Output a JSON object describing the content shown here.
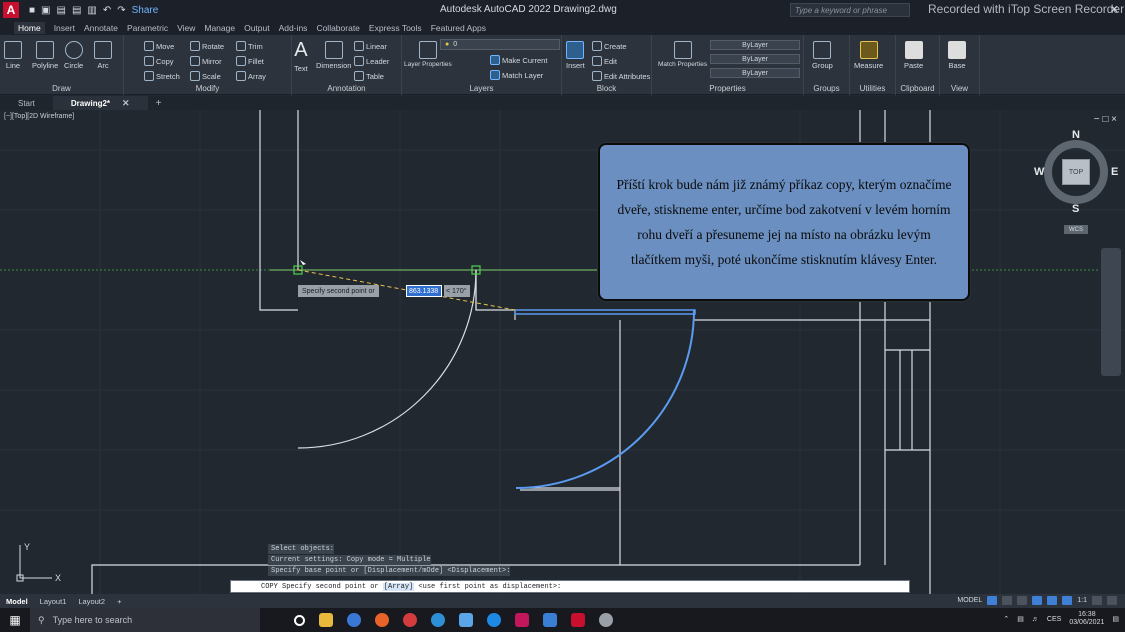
{
  "titlebar": {
    "app_logo": "A",
    "share": "Share",
    "title": "Autodesk AutoCAD 2022   Drawing2.dwg",
    "search_placeholder": "Type a keyword or phrase",
    "recorder_watermark": "Recorded with iTop Screen Recorder"
  },
  "ribbon_tabs": [
    "Home",
    "Insert",
    "Annotate",
    "Parametric",
    "View",
    "Manage",
    "Output",
    "Add-ins",
    "Collaborate",
    "Express Tools",
    "Featured Apps"
  ],
  "ribbon": {
    "draw": {
      "title": "Draw",
      "line": "Line",
      "polyline": "Polyline",
      "circle": "Circle",
      "arc": "Arc"
    },
    "modify": {
      "title": "Modify",
      "move": "Move",
      "rotate": "Rotate",
      "trim": "Trim",
      "copy": "Copy",
      "mirror": "Mirror",
      "fillet": "Fillet",
      "stretch": "Stretch",
      "scale": "Scale",
      "array": "Array"
    },
    "annotation": {
      "title": "Annotation",
      "text": "Text",
      "dimension": "Dimension",
      "linear": "Linear",
      "leader": "Leader",
      "table": "Table"
    },
    "layers": {
      "title": "Layers",
      "layer_properties": "Layer Properties",
      "layer_value": "0",
      "make_current": "Make Current",
      "match_layer": "Match Layer"
    },
    "block": {
      "title": "Block",
      "insert": "Insert",
      "create": "Create",
      "edit": "Edit",
      "edit_attributes": "Edit Attributes"
    },
    "properties": {
      "title": "Properties",
      "match_properties": "Match Properties",
      "bylayer_1": "ByLayer",
      "bylayer_2": "ByLayer",
      "bylayer_3": "ByLayer"
    },
    "groups": {
      "title": "Groups",
      "group": "Group"
    },
    "utilities": {
      "title": "Utilities",
      "measure": "Measure"
    },
    "clipboard": {
      "title": "Clipboard",
      "paste": "Paste"
    },
    "view": {
      "title": "View",
      "base": "Base"
    }
  },
  "doc_tabs": {
    "start": "Start",
    "drawing": "Drawing2*"
  },
  "viewport": {
    "label": "[−][Top][2D Wireframe]",
    "controls": "− □ ×"
  },
  "viewcube": {
    "n": "N",
    "s": "S",
    "e": "E",
    "w": "W",
    "top": "TOP",
    "wcs": "WCS"
  },
  "callout": {
    "text": "Příští krok bude nám již známý příkaz copy, kterým označíme dveře, stiskneme enter, určíme bod zakotvení v levém horním rohu dveří a přesuneme jej na místo na obrázku levým tlačítkem myši, poté ukončíme stisknutím klávesy Enter."
  },
  "dynamic_input": {
    "prompt": "Specify second point or",
    "distance": "863.1338",
    "angle": "< 170°"
  },
  "command_history": [
    "Select objects:",
    "Current settings:  Copy mode = Multiple",
    "Specify base point or [Displacement/mOde] <Displacement>:"
  ],
  "command_line": {
    "prefix": "COPY Specify second point or ",
    "option": "[Array]",
    "suffix": " <use first point as displacement>:"
  },
  "ucs": {
    "y": "Y",
    "x": "X"
  },
  "layout_tabs": [
    "Model",
    "Layout1",
    "Layout2"
  ],
  "status": {
    "model": "MODEL",
    "scale": "1:1"
  },
  "taskbar": {
    "search_placeholder": "Type here to search",
    "lang": "CES",
    "time": "16:38",
    "date": "03/06/2021"
  }
}
